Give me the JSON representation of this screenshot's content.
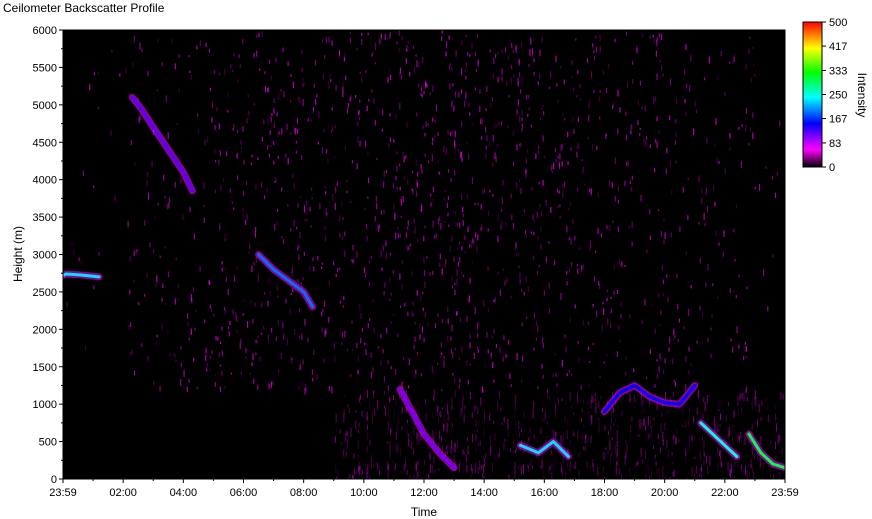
{
  "chart_data": {
    "type": "heatmap",
    "title": "Ceilometer Backscatter Profile",
    "xlabel": "Time",
    "ylabel": "Height (m)",
    "x_tick_labels": [
      "23:59",
      "02:00",
      "04:00",
      "06:00",
      "08:00",
      "10:00",
      "12:00",
      "14:00",
      "16:00",
      "18:00",
      "20:00",
      "22:00",
      "23:59"
    ],
    "x_tick_hours": [
      0,
      2,
      4,
      6,
      8,
      10,
      12,
      14,
      16,
      18,
      20,
      22,
      24
    ],
    "xlim_hours": [
      0,
      24
    ],
    "ylim": [
      0,
      6000
    ],
    "y_ticks": [
      0,
      500,
      1000,
      1500,
      2000,
      2500,
      3000,
      3500,
      4000,
      4500,
      5000,
      5500,
      6000
    ],
    "colorbar": {
      "label": "Intensity",
      "range": [
        0,
        500
      ],
      "ticks": [
        0,
        83,
        167,
        250,
        333,
        417,
        500
      ],
      "colors": [
        "#000000",
        "#ff00ff",
        "#0000ff",
        "#00ffff",
        "#00ff00",
        "#ffff00",
        "#ff0000"
      ]
    },
    "background_color": "#000000",
    "noise_color": "#ff00ff",
    "layers": [
      {
        "name": "dry-layer",
        "hours": [
          0,
          0.1,
          0.5,
          1.0,
          1.2
        ],
        "heights": [
          2720,
          2740,
          2730,
          2710,
          2700
        ],
        "intensity": 230
      },
      {
        "name": "descending-layer",
        "hours": [
          2.3,
          2.6,
          3.0,
          3.5,
          4.0,
          4.3
        ],
        "heights": [
          5100,
          4950,
          4700,
          4400,
          4100,
          3850
        ],
        "intensity": 120
      },
      {
        "name": "descending-layer-2",
        "hours": [
          6.5,
          7.0,
          7.5,
          8.0,
          8.3
        ],
        "heights": [
          3000,
          2800,
          2650,
          2500,
          2300
        ],
        "intensity": 190
      },
      {
        "name": "boundary-layer",
        "hours": [
          11.2,
          11.6,
          12.0,
          12.5,
          13.0
        ],
        "heights": [
          1200,
          900,
          600,
          350,
          150
        ],
        "intensity": 110
      },
      {
        "name": "afternoon-cloud",
        "hours": [
          15.2,
          15.8,
          16.3,
          16.8
        ],
        "heights": [
          450,
          350,
          500,
          300
        ],
        "intensity": 230
      },
      {
        "name": "evening-cloud",
        "hours": [
          18.0,
          18.5,
          19.0,
          19.5,
          20.0,
          20.5,
          21.0
        ],
        "heights": [
          900,
          1150,
          1250,
          1100,
          1020,
          1000,
          1250
        ],
        "intensity": 150
      },
      {
        "name": "night-cloud",
        "hours": [
          21.2,
          21.6,
          22.0,
          22.4
        ],
        "heights": [
          750,
          600,
          450,
          300
        ],
        "intensity": 250
      },
      {
        "name": "late-cloud",
        "hours": [
          22.8,
          23.2,
          23.6,
          24.0
        ],
        "heights": [
          600,
          350,
          200,
          150
        ],
        "intensity": 300
      }
    ]
  }
}
